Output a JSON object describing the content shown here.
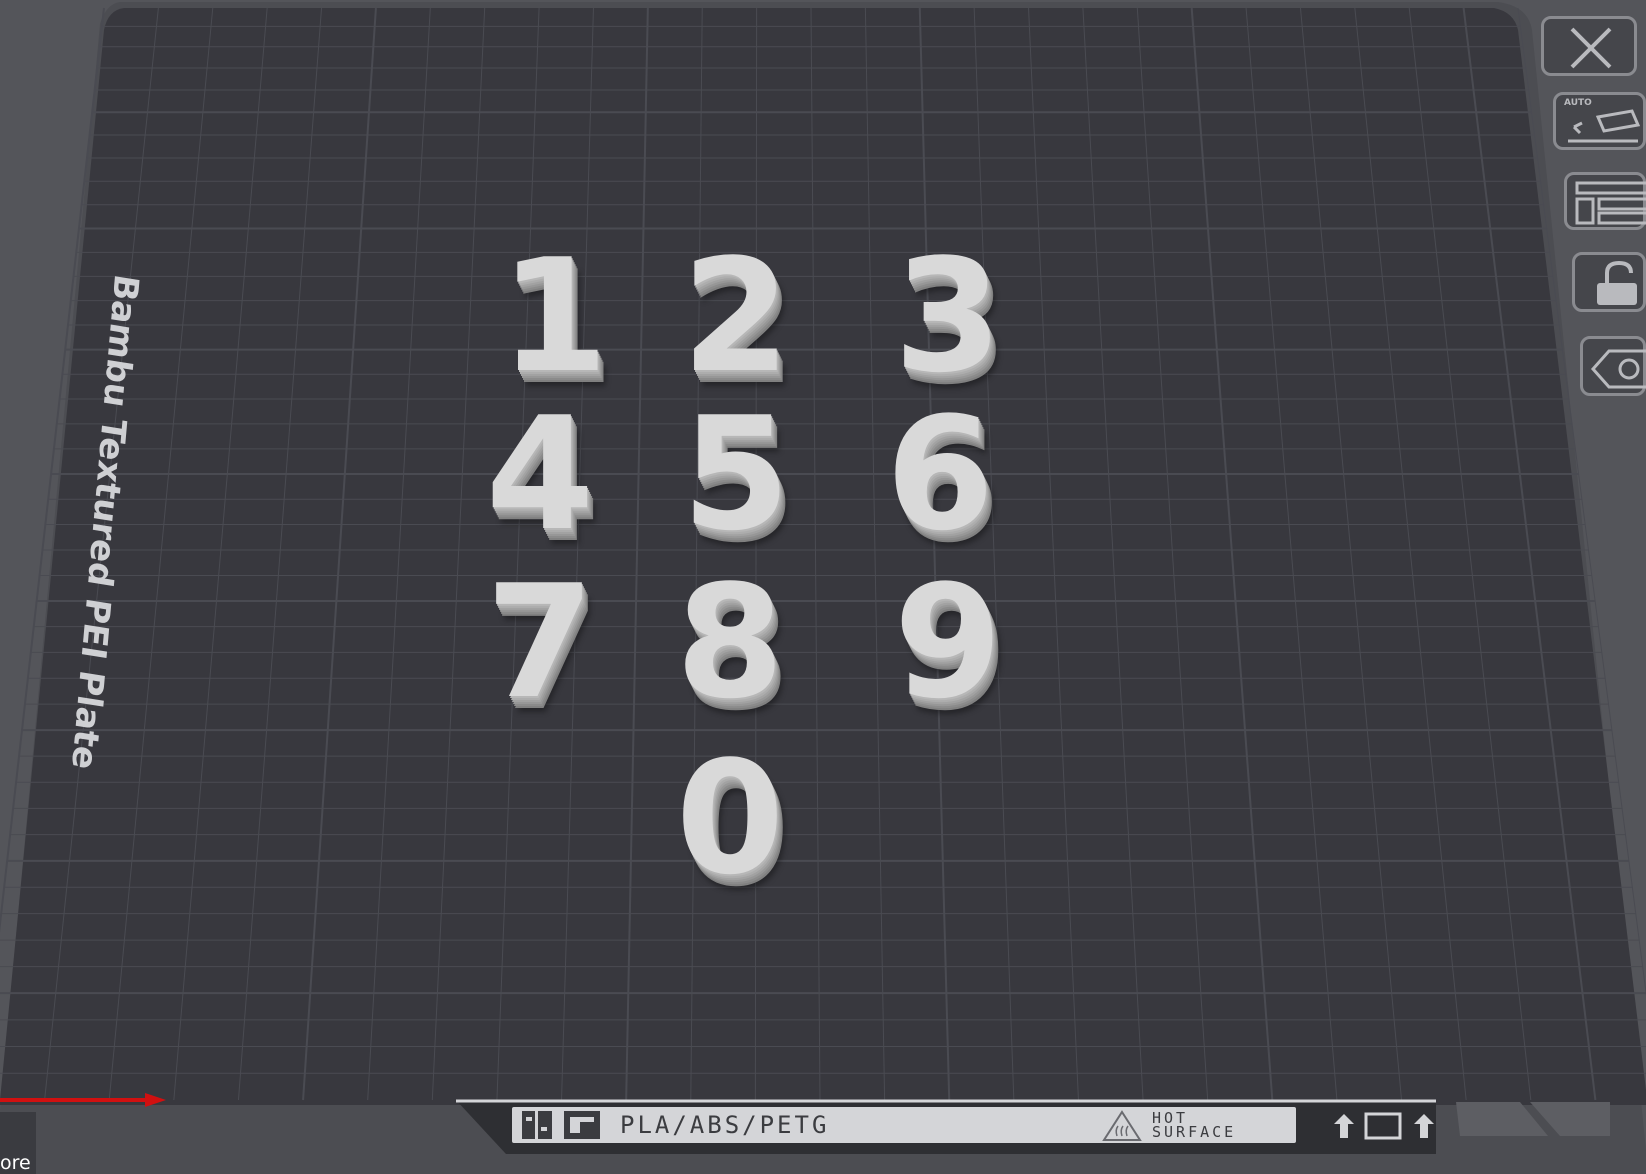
{
  "bed": {
    "plate_label": "Bambu Textured PEI Plate",
    "material_label": "PLA/ABS/PETG",
    "hot_line1": "HOT",
    "hot_line2": "SURFACE"
  },
  "objects": [
    {
      "label": "1"
    },
    {
      "label": "2"
    },
    {
      "label": "3"
    },
    {
      "label": "4"
    },
    {
      "label": "5"
    },
    {
      "label": "6"
    },
    {
      "label": "7"
    },
    {
      "label": "8"
    },
    {
      "label": "9"
    },
    {
      "label": "0"
    }
  ],
  "toolbar": {
    "close_icon": "close-icon",
    "auto_label": "AUTO",
    "auto_orient_icon": "auto-orient-icon",
    "arrange_icon": "arrange-icon",
    "lock_icon": "unlock-icon",
    "plate_settings_icon": "plate-settings-icon"
  },
  "overlay": {
    "more_label": "ore"
  },
  "colors": {
    "background": "#54555a",
    "bed": "#38383e",
    "grid": "#4a4b52",
    "objects": "#d9d9d9",
    "x_axis": "#d11010"
  }
}
